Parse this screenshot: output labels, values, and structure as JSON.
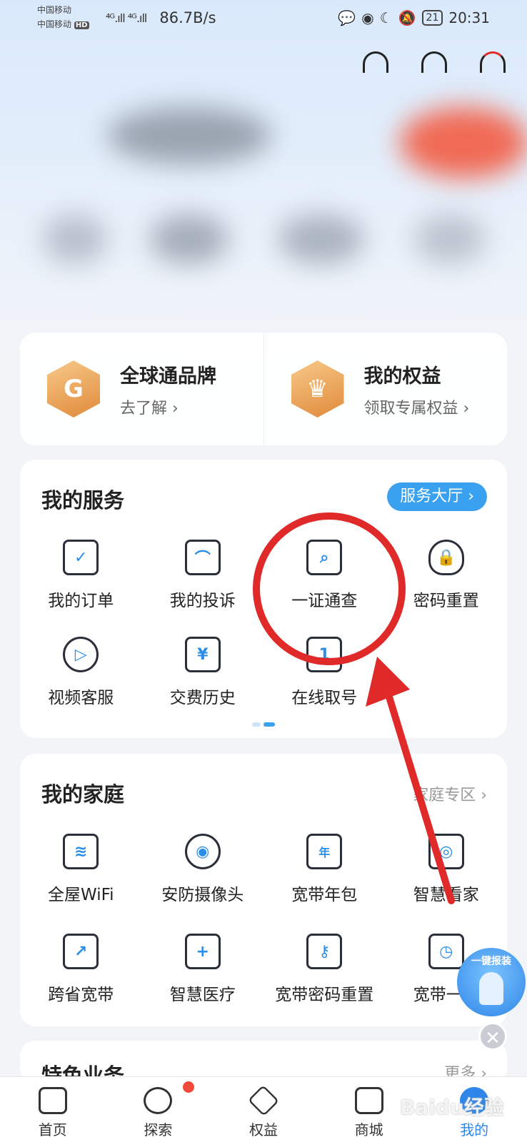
{
  "status_bar": {
    "carrier1": "中国移动",
    "carrier2": "中国移动",
    "hd": "HD",
    "signal": "⁴ᴳ.ıll ⁴ᴳ.ıll",
    "net_speed": "86.7B/s",
    "battery": "21",
    "time": "20:31"
  },
  "brand": {
    "left": {
      "title": "全球通品牌",
      "sub": "去了解 ›"
    },
    "right": {
      "title": "我的权益",
      "sub": "领取专属权益 ›"
    }
  },
  "services": {
    "title": "我的服务",
    "hall_button": "服务大厅 ›",
    "items": [
      {
        "label": "我的订单",
        "icon": "clipboard-check-icon",
        "glyph": "✓"
      },
      {
        "label": "我的投诉",
        "icon": "chat-bubble-icon",
        "glyph": "⌒"
      },
      {
        "label": "一证通查",
        "icon": "document-search-icon",
        "glyph": "⌕"
      },
      {
        "label": "密码重置",
        "icon": "shield-lock-icon",
        "glyph": "🔒"
      },
      {
        "label": "视频客服",
        "icon": "headset-icon",
        "glyph": "▷"
      },
      {
        "label": "交费历史",
        "icon": "receipt-yen-icon",
        "glyph": "¥"
      },
      {
        "label": "在线取号",
        "icon": "ticket-number-icon",
        "glyph": "1"
      }
    ]
  },
  "family": {
    "title": "我的家庭",
    "zone_link": "家庭专区 ›",
    "items": [
      {
        "label": "全屋WiFi",
        "icon": "home-wifi-icon",
        "glyph": "≋"
      },
      {
        "label": "安防摄像头",
        "icon": "camera-icon",
        "glyph": "◉"
      },
      {
        "label": "宽带年包",
        "icon": "router-year-icon",
        "glyph": "年"
      },
      {
        "label": "智慧看家",
        "icon": "home-camera-icon",
        "glyph": "◎"
      },
      {
        "label": "跨省宽带",
        "icon": "monitor-share-icon",
        "glyph": "↗"
      },
      {
        "label": "智慧医疗",
        "icon": "medical-kit-icon",
        "glyph": "+"
      },
      {
        "label": "宽带密码重置",
        "icon": "monitor-key-icon",
        "glyph": "⚷"
      },
      {
        "label": "宽带一键",
        "icon": "monitor-clock-icon",
        "glyph": "◷"
      }
    ]
  },
  "next_section": {
    "title": "特色业务",
    "more": "更多 ›"
  },
  "floating": {
    "title": "一键报装",
    "close": "✕"
  },
  "bottom_nav": [
    {
      "label": "首页",
      "icon": "home-tab-icon"
    },
    {
      "label": "探索",
      "icon": "compass-icon"
    },
    {
      "label": "权益",
      "icon": "diamond-icon"
    },
    {
      "label": "商城",
      "icon": "shopping-bag-icon"
    },
    {
      "label": "我的",
      "icon": "profile-icon"
    }
  ],
  "watermark": "Baidu经验",
  "colors": {
    "accent": "#3aa0f0",
    "annotation": "#e02a2a",
    "badge": "#f04a3a"
  }
}
